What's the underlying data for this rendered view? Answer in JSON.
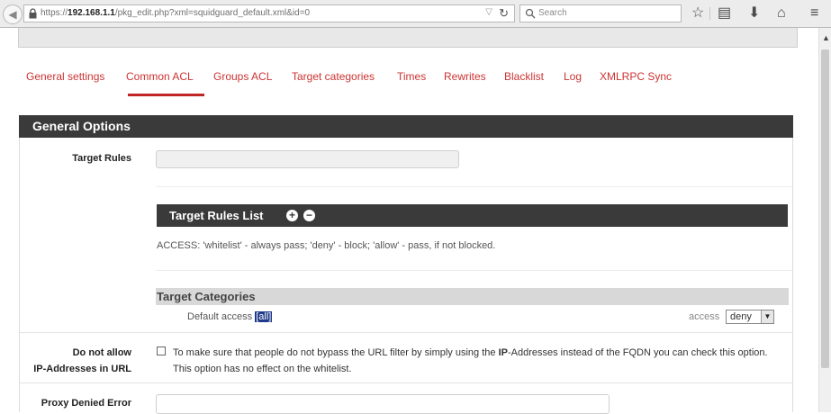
{
  "browser": {
    "url_prefix": "https://",
    "url_host": "192.168.1.1",
    "url_path": "/pkg_edit.php?xml=squidguard_default.xml&id=0",
    "search_placeholder": "Search"
  },
  "tabs": [
    {
      "label": "General settings"
    },
    {
      "label": "Common ACL",
      "active": true
    },
    {
      "label": "Groups ACL"
    },
    {
      "label": "Target categories"
    },
    {
      "label": "Times"
    },
    {
      "label": "Rewrites"
    },
    {
      "label": "Blacklist"
    },
    {
      "label": "Log"
    },
    {
      "label": "XMLRPC Sync"
    }
  ],
  "section": {
    "title": "General Options"
  },
  "target_rules": {
    "label": "Target Rules",
    "value": ""
  },
  "target_rules_list": {
    "title": "Target Rules List"
  },
  "access_note": "ACCESS: 'whitelist' - always pass; 'deny' - block; 'allow' - pass, if not blocked.",
  "target_categories": {
    "title": "Target Categories",
    "default_access_label": "Default access",
    "default_access_value": "[all]",
    "access_label": "access",
    "access_value": "deny"
  },
  "ip_option": {
    "label_line1": "Do not allow",
    "label_line2": "IP-Addresses in URL",
    "checked": false,
    "text_pre": "To make sure that people do not bypass the URL filter by simply using the ",
    "text_bold": "IP",
    "text_post": "-Addresses instead of the FQDN you can check this option. This option has no effect on the whitelist."
  },
  "proxy_denied": {
    "label": "Proxy Denied Error",
    "value": ""
  },
  "colors": {
    "tab_text": "#cc3333",
    "tab_active_underline": "#c02626",
    "header_bg": "#3a3a3a",
    "selection": "#1f3a8a"
  }
}
